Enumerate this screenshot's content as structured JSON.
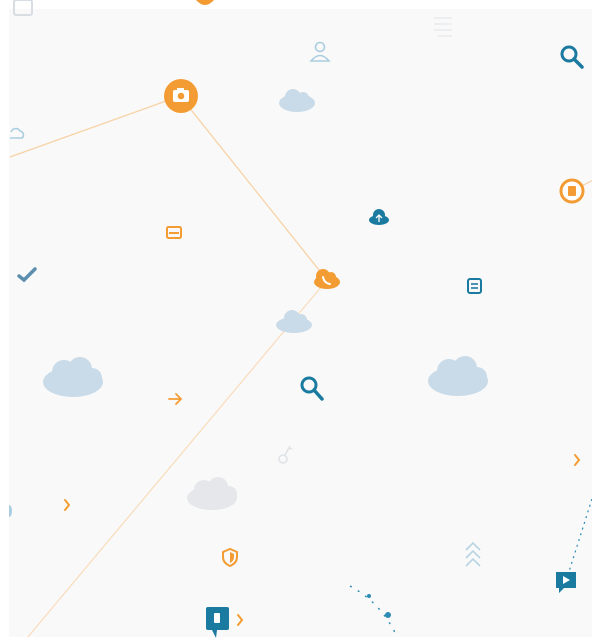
{
  "colors": {
    "background": "#f9f9f9",
    "orange": "#f39c33",
    "orange_light": "#f6b86b",
    "teal": "#1b7aa0",
    "teal_light": "#9cc7da",
    "cloud_blue": "#c9dbe8",
    "cloud_grey": "#e5e7ea",
    "line_orange": "#f7d2a6",
    "line_teal": "#2c8cb3"
  },
  "icons": [
    "camera-icon",
    "search-icon",
    "user-icon",
    "cloud-icon",
    "document-icon",
    "upload-cloud-icon",
    "card-icon",
    "checkmark-icon",
    "phone-cloud-icon",
    "list-icon",
    "arrow-right-icon",
    "chevron-right-icon",
    "key-icon",
    "shield-icon",
    "chevrons-up-icon",
    "chat-bubble-icon",
    "video-chat-icon",
    "signal-icon"
  ]
}
